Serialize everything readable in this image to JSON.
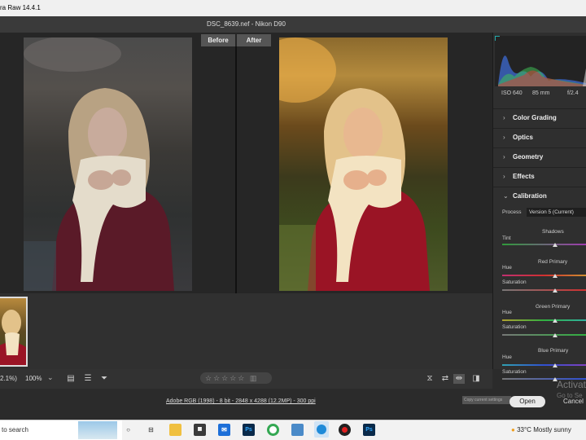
{
  "window": {
    "title": "ra Raw 14.4.1",
    "doc_title": "DSC_8639.nef  -  Nikon D90"
  },
  "compare": {
    "before_label": "Before",
    "after_label": "After"
  },
  "camera_info": {
    "iso": "ISO 640",
    "focal": "85 mm",
    "aperture": "f/2.4"
  },
  "panels": {
    "color_grading": "Color Grading",
    "optics": "Optics",
    "geometry": "Geometry",
    "effects": "Effects",
    "calibration": "Calibration"
  },
  "calibration": {
    "process_label": "Process",
    "process_value": "Version 5 (Current)",
    "shadows_label": "Shadows",
    "tint_label": "Tint",
    "red_primary_label": "Red Primary",
    "green_primary_label": "Green Primary",
    "blue_primary_label": "Blue Primary",
    "hue_label": "Hue",
    "saturation_label": "Saturation"
  },
  "toolbar": {
    "zoom_fit": "2.1%)",
    "zoom_value": "100%",
    "stars": "☆☆☆☆☆"
  },
  "footer": {
    "workflow_text": "Adobe RGB (1998) - 8 bit - 2848 x 4288 (12.2MP) - 300 ppi",
    "copy_hint": "Copy current settings",
    "open_label": "Open",
    "cancel_label": "Cancel",
    "activate_title": "Activat",
    "activate_sub": "Go to Se"
  },
  "taskbar": {
    "search_text": "to search",
    "temperature": "33°C",
    "weather": "Mostly sunny"
  },
  "colors": {
    "accent": "#e8e8e8",
    "panel_bg": "#2f2f2f"
  }
}
